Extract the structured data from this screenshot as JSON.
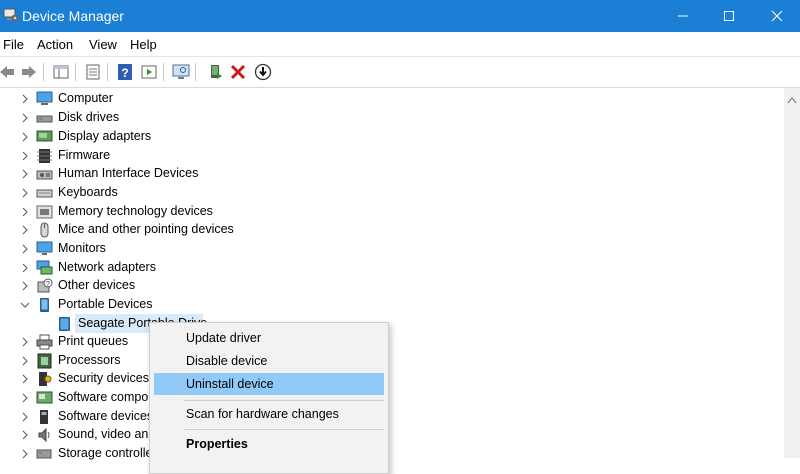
{
  "window": {
    "title": "Device Manager",
    "accent": "#1c7fd6"
  },
  "menu": [
    "File",
    "Action",
    "View",
    "Help"
  ],
  "toolbar": {
    "icons": [
      "back-arrow-icon",
      "forward-arrow-icon",
      "console-tree-icon",
      "properties-icon",
      "help-icon",
      "action-pane-icon",
      "monitor-scan-icon",
      "update-driver-icon",
      "uninstall-icon",
      "disable-device-icon"
    ]
  },
  "tree": {
    "items": [
      {
        "label": "Computer",
        "expanded": false
      },
      {
        "label": "Disk drives",
        "expanded": false
      },
      {
        "label": "Display adapters",
        "expanded": false
      },
      {
        "label": "Firmware",
        "expanded": false
      },
      {
        "label": "Human Interface Devices",
        "expanded": false
      },
      {
        "label": "Keyboards",
        "expanded": false
      },
      {
        "label": "Memory technology devices",
        "expanded": false
      },
      {
        "label": "Mice and other pointing devices",
        "expanded": false
      },
      {
        "label": "Monitors",
        "expanded": false
      },
      {
        "label": "Network adapters",
        "expanded": false
      },
      {
        "label": "Other devices",
        "expanded": false
      },
      {
        "label": "Portable Devices",
        "expanded": true
      },
      {
        "label": "Seagate Portable Drive",
        "child": true,
        "selected": true
      },
      {
        "label": "Print queues",
        "expanded": false
      },
      {
        "label": "Processors",
        "expanded": false
      },
      {
        "label": "Security devices",
        "expanded": false
      },
      {
        "label": "Software compon",
        "expanded": false
      },
      {
        "label": "Software devices",
        "expanded": false
      },
      {
        "label": "Sound, video and",
        "expanded": false
      },
      {
        "label": "Storage controlle",
        "expanded": false
      }
    ]
  },
  "context_menu": {
    "items": [
      {
        "label": "Update driver"
      },
      {
        "label": "Disable device"
      },
      {
        "label": "Uninstall device",
        "highlighted": true
      },
      {
        "label": "Scan for hardware changes"
      },
      {
        "label": "Properties",
        "bold": true
      }
    ],
    "highlight_color": "#91c9f7"
  }
}
